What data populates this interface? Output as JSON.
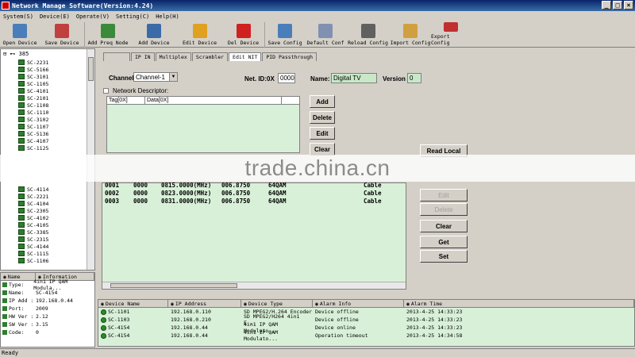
{
  "window": {
    "title": "Network Manage Software(Version:4.24)",
    "buttons": [
      "_",
      "□",
      "×"
    ]
  },
  "menu": [
    "System(S)",
    "Device(E)",
    "Operate(V)",
    "Setting(C)",
    "Help(H)"
  ],
  "toolbar": [
    {
      "label": "Open Device",
      "icon": "open-device-icon",
      "color": "#4a7ebb"
    },
    {
      "label": "Save Device",
      "icon": "save-device-icon",
      "color": "#c04040"
    },
    {
      "label": "Add Preq Node",
      "icon": "add-node-icon",
      "color": "#3a8a3a"
    },
    {
      "label": "Add Device",
      "icon": "add-device-icon",
      "color": "#3a6aa8"
    },
    {
      "label": "Edit Device",
      "icon": "edit-device-icon",
      "color": "#e0a020"
    },
    {
      "label": "Del Device",
      "icon": "delete-device-icon",
      "color": "#d02020"
    },
    {
      "label": "Save Config",
      "icon": "save-config-icon",
      "color": "#4a7ebb"
    },
    {
      "label": "Default Conf",
      "icon": "default-config-icon",
      "color": "#8090b0"
    },
    {
      "label": "Reload Config",
      "icon": "reload-config-icon",
      "color": "#606060"
    },
    {
      "label": "Import Config",
      "icon": "import-config-icon",
      "color": "#d0a040"
    },
    {
      "label": "Export Config",
      "icon": "export-config-icon",
      "color": "#c03030"
    }
  ],
  "tree": {
    "root": "385",
    "items": [
      "SC-2231",
      "SC-5166",
      "SC-3101",
      "SC-1105",
      "SC-4101",
      "SC-2101",
      "SC-1108",
      "SC-1110",
      "SC-3102",
      "SC-1107",
      "SC-5136",
      "SC-4107",
      "SC-1125",
      "SC-4114",
      "SC-2221",
      "SC-4104",
      "SC-2305",
      "SC-4102",
      "SC-4105",
      "SC-3385",
      "SC-2315",
      "SC-4144",
      "SC-1115",
      "SC-1106"
    ]
  },
  "info": {
    "headers": [
      "Name",
      "Information"
    ],
    "rows": [
      {
        "k": "Type:",
        "v": "4in1 IP QAM Modula..."
      },
      {
        "k": "Name:",
        "v": "SC-4154"
      },
      {
        "k": "IP Add :",
        "v": "192.168.0.44"
      },
      {
        "k": "Port:",
        "v": "2009"
      },
      {
        "k": "HW Ver :",
        "v": "2.12"
      },
      {
        "k": "SW Ver :",
        "v": "3.15"
      },
      {
        "k": "Code:",
        "v": "0"
      }
    ]
  },
  "tabs": [
    "IP IN",
    "Multiplex",
    "Scrambler",
    "Edit NIT",
    "PID Passthrough"
  ],
  "form": {
    "channel_label": "Channel",
    "channel_value": "Channel-1",
    "netid_label": "Net. ID:0X",
    "netid_value": "0000",
    "name_label": "Name:",
    "name_value": "Digital TV",
    "version_label": "Version",
    "version_value": "0",
    "descriptor_label": "Network Descriptor:",
    "desc_cols": [
      "Tag[0X]",
      "Data[0X]"
    ]
  },
  "buttons": {
    "add": "Add",
    "delete": "Delete",
    "edit": "Edit",
    "clear": "Clear",
    "read_local": "Read Local",
    "edit2": "Edit",
    "delete2": "Delete",
    "clear2": "Clear",
    "get": "Get",
    "set": "Set"
  },
  "channels": [
    {
      "a": "0001",
      "b": "0000",
      "freq": "0815.0000(MHz)",
      "sr": "006.8750",
      "mod": "64QAM",
      "type": "Cable"
    },
    {
      "a": "0002",
      "b": "0000",
      "freq": "0823.0000(MHz)",
      "sr": "006.8750",
      "mod": "64QAM",
      "type": "Cable"
    },
    {
      "a": "0003",
      "b": "0000",
      "freq": "0831.0000(MHz)",
      "sr": "006.8750",
      "mod": "64QAM",
      "type": "Cable"
    }
  ],
  "alarm": {
    "headers": [
      "Device Name",
      "IP Address",
      "Device Type",
      "Alarm Info",
      "Alarm Time"
    ],
    "rows": [
      {
        "name": "SC-1101",
        "ip": "192.168.0.110",
        "type": "SD MPEG2/H.264 Encoder",
        "info": "Device offline",
        "time": "2013-4-25 14:33:23"
      },
      {
        "name": "SC-1103",
        "ip": "192.168.0.210",
        "type": "SD MPEG2/H264 4in1 E...",
        "info": "Device offline",
        "time": "2013-4-25 14:33:23"
      },
      {
        "name": "SC-4154",
        "ip": "192.168.0.44",
        "type": "4in1 IP QAM Modulato...",
        "info": "Device online",
        "time": "2013-4-25 14:33:23"
      },
      {
        "name": "SC-4154",
        "ip": "192.168.0.44",
        "type": "4in1 IP QAM Modulato...",
        "info": "Operation timeout",
        "time": "2013-4-25 14:34:58"
      }
    ]
  },
  "watermark": "trade.china.cn",
  "status": "Ready"
}
